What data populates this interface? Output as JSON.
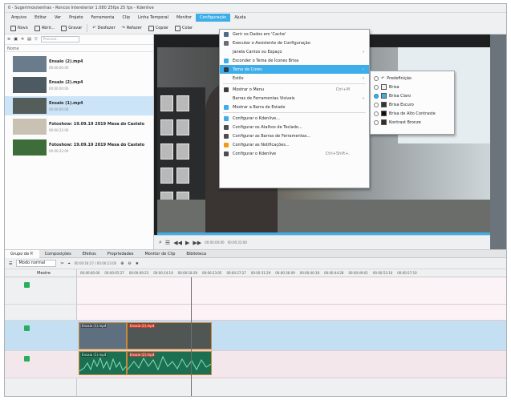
{
  "window": {
    "title": "0 - Sugerimos/senhas - Roncos Intereterior 1.080 25fps 25 fps - Kdenlive"
  },
  "menubar": [
    {
      "label": "Arquivo"
    },
    {
      "label": "Editar"
    },
    {
      "label": "Ver"
    },
    {
      "label": "Projeto"
    },
    {
      "label": "Ferramenta"
    },
    {
      "label": "Clip"
    },
    {
      "label": "Linha Temporal"
    },
    {
      "label": "Monitor"
    },
    {
      "label": "Configuração",
      "active": true
    },
    {
      "label": "Ajuda"
    }
  ],
  "toolbar": [
    {
      "label": "Novo",
      "icon": "new-document-icon"
    },
    {
      "label": "Abrir...",
      "icon": "open-folder-icon"
    },
    {
      "label": "Gravar",
      "icon": "save-icon"
    },
    {
      "label": "Desfazer",
      "icon": "undo-icon"
    },
    {
      "label": "Refazer",
      "icon": "redo-icon"
    },
    {
      "label": "Copiar",
      "icon": "copy-icon"
    },
    {
      "label": "Colar",
      "icon": "paste-icon"
    }
  ],
  "bin": {
    "search_placeholder": "Procurar...",
    "column_header": "Nome",
    "clips": [
      {
        "name": "Ensaio (2).mp4",
        "meta": "00:00:00:00",
        "thumb_color": "#6a7b8c",
        "selected": false
      },
      {
        "name": "Ensaio (2).mp4",
        "meta": "00:00:00:00",
        "thumb_color": "#4d5a62",
        "selected": false
      },
      {
        "name": "Ensaio (1).mp4",
        "meta": "00:00:00:00",
        "thumb_color": "#555d5a",
        "selected": true
      },
      {
        "name": "Fotoshow: 19.09.19 2019 Mesa do Castelo",
        "meta": "00:00:22:00",
        "thumb_color": "#c9c1b3",
        "selected": false
      },
      {
        "name": "Fotoshow: 19.09.19 2019 Mesa do Castelo",
        "meta": "00:00:22:00",
        "thumb_color": "#3d6e3a",
        "selected": false
      }
    ]
  },
  "monitor": {
    "timecode": "00:00:00:00",
    "duration": "00:00:22:00"
  },
  "tabs": [
    {
      "label": "Grupo de P."
    },
    {
      "label": "Composições"
    },
    {
      "label": "Efeitos"
    },
    {
      "label": "Propriedades"
    },
    {
      "label": "Monitor de Clip"
    },
    {
      "label": "Biblioteca"
    }
  ],
  "timeline": {
    "mode_label": "Modo normal",
    "timecode": "00:00:18:27 / 00:00:23:00",
    "heads_label": "Mestre",
    "ruler": [
      "00:00:00:00",
      "00:00:05:27",
      "00:00:09:23",
      "00:00:14:19",
      "00:00:18:29",
      "00:00:23:05",
      "00:00:27:27",
      "00:00:31:29",
      "00:00:36:09",
      "00:00:40:18",
      "00:00:44:28",
      "00:00:49:01",
      "00:00:53:10",
      "00:00:57:10"
    ],
    "clips": [
      {
        "label": "Ensaio (1).mp4"
      },
      {
        "label": "Ensaio (2).mp4"
      }
    ],
    "audio": [
      {
        "label": "Ensaio (1).mp4"
      },
      {
        "label": "Ensaio (2).mp4"
      }
    ]
  },
  "settings_menu": {
    "items": [
      {
        "label": "Gerir os Dados em 'Cache'",
        "icon": "cache-icon",
        "icon_color": "#4d6b8a"
      },
      {
        "label": "Executar o Assistente de Configuração",
        "icon": "wizard-icon",
        "icon_color": "#6a6e72"
      },
      {
        "label": "Janela Cantos ou Espaço",
        "arrow": "›"
      },
      {
        "label": "Esconder o Tema de Ícones Brisa",
        "icon": "checkbox-icon",
        "icon_color": "#3daee9"
      },
      {
        "label": "Tema de Cores",
        "icon": "palette-icon",
        "icon_color": "#2f3a44",
        "arrow": "›",
        "highlight": true
      },
      {
        "label": "Estilo",
        "arrow": "›"
      },
      {
        "label": "Mostrar o Menu",
        "icon": "menu-icon",
        "icon_color": "#3b3f42",
        "shortcut": "Ctrl+M",
        "sep_before": true
      },
      {
        "label": "Barras de Ferramentas Visíveis",
        "arrow": "›"
      },
      {
        "label": "Mostrar a Barra de Estado",
        "icon": "checkbox-icon",
        "icon_color": "#3daee9"
      },
      {
        "label": "Configurar o Kdenlive...",
        "icon": "settings-icon",
        "icon_color": "#3daee9",
        "sep_before": true
      },
      {
        "label": "Configurar os Atalhos de Teclado...",
        "icon": "keyboard-icon",
        "icon_color": "#4d4d4d"
      },
      {
        "label": "Configurar as Barras de Ferramentas...",
        "icon": "toolbar-config-icon",
        "icon_color": "#4d4d4d"
      },
      {
        "label": "Configurar as Notificações...",
        "icon": "notification-icon",
        "icon_color": "#f39c12"
      },
      {
        "label": "Configurar o Kdenlive",
        "icon": "kdenlive-icon",
        "icon_color": "#4d4d4d",
        "shortcut": "Ctrl+Shift+,"
      }
    ]
  },
  "color_submenu": [
    {
      "label": "Predefinição",
      "icon": "undo-icon",
      "swatch": "#ffffff",
      "on": false
    },
    {
      "label": "Brisa",
      "swatch": "#eff0f1",
      "on": false
    },
    {
      "label": "Brisa Claro",
      "swatch": "#3daee9",
      "on": true
    },
    {
      "label": "Brisa Escuro",
      "swatch": "#31363b",
      "on": false
    },
    {
      "label": "Brisa de Alto Contraste",
      "swatch": "#111111",
      "on": false
    },
    {
      "label": "Kontrast Bronze",
      "swatch": "#3b2a1a",
      "on": false
    }
  ]
}
